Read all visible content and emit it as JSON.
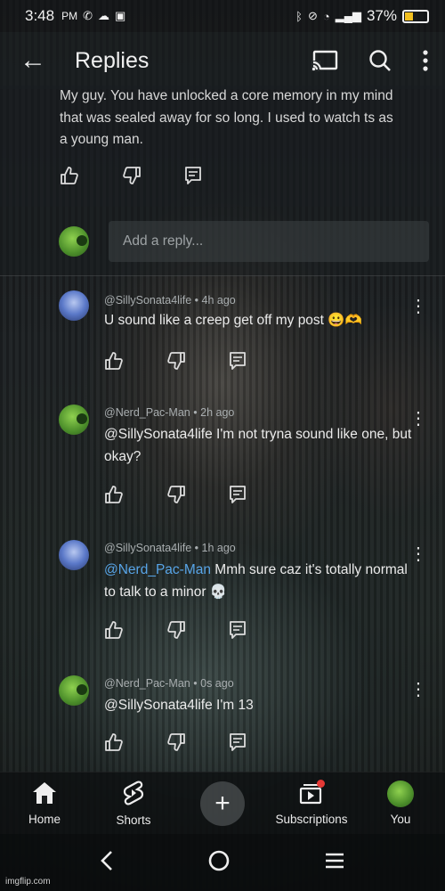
{
  "status_bar": {
    "time": "3:48",
    "ampm": "PM",
    "battery": "37%",
    "battery_level": 0.37
  },
  "app_bar": {
    "title": "Replies"
  },
  "parent_comment": {
    "text": "My guy. You have unlocked a core memory in my mind that was sealed away for so long. I used to watch ts as a young man."
  },
  "reply_box": {
    "placeholder": "Add a reply..."
  },
  "replies": [
    {
      "author": "@SillySonata4life",
      "time": "4h ago",
      "text": "U sound like a creep get off my post 😀🫶"
    },
    {
      "author": "@Nerd_Pac-Man",
      "time": "2h ago",
      "text": "@SillySonata4life I'm not tryna sound like one, but okay?"
    },
    {
      "author": "@SillySonata4life",
      "time": "1h ago",
      "mention": "@Nerd_Pac-Man",
      "text": " Mmh sure caz it's totally normal to talk to a minor 💀"
    },
    {
      "author": "@Nerd_Pac-Man",
      "time": "0s ago",
      "text": "@SillySonata4life I'm 13"
    }
  ],
  "meta_separator": "•",
  "bottom_nav": {
    "home": "Home",
    "shorts": "Shorts",
    "create": "+",
    "subscriptions": "Subscriptions",
    "you": "You"
  },
  "watermark": "imgflip.com",
  "colors": {
    "mention": "#58a5e8",
    "battery": "#f3c020",
    "notification": "#e53935"
  }
}
